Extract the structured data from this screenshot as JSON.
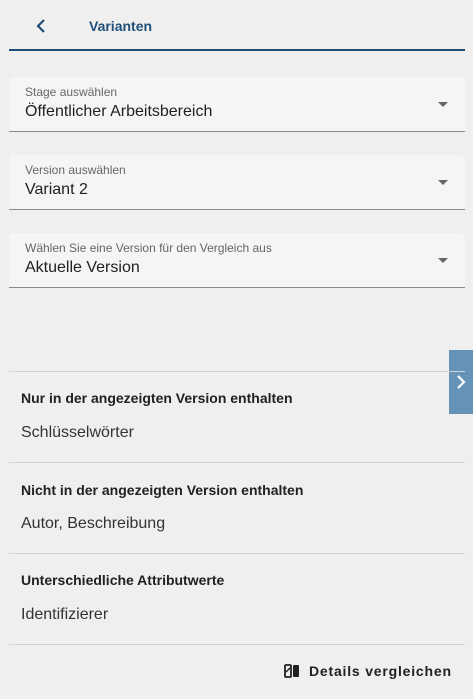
{
  "header": {
    "title": "Varianten",
    "back_icon": "chevron-left-icon"
  },
  "selects": {
    "stage": {
      "label": "Stage auswählen",
      "value": "Öffentlicher Arbeitsbereich"
    },
    "version": {
      "label": "Version auswählen",
      "value": "Variant 2"
    },
    "compare": {
      "label": "Wählen Sie eine Version für den Vergleich aus",
      "value": "Aktuelle Version"
    }
  },
  "sections": [
    {
      "title": "Nur in der angezeigten Version enthalten",
      "value": "Schlüsselwörter"
    },
    {
      "title": "Nicht in der angezeigten Version enthalten",
      "value": "Autor, Beschreibung"
    },
    {
      "title": "Unterschiedliche Attributwerte",
      "value": "Identifizierer"
    }
  ],
  "footer": {
    "compare_label": "Details vergleichen",
    "compare_icon": "compare-icon"
  },
  "colors": {
    "accent": "#1f4e78",
    "toggle": "#6593b8",
    "background": "#efefef"
  }
}
